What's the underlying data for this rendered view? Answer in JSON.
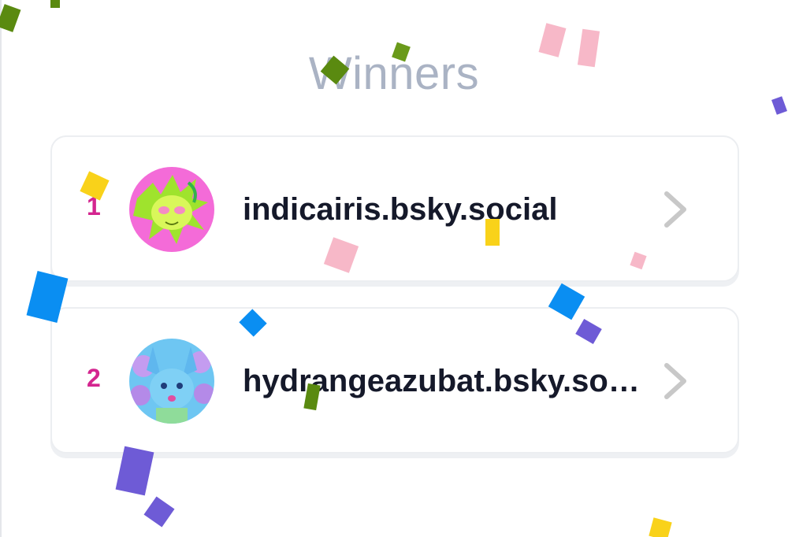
{
  "header": {
    "title": "Winners"
  },
  "winners": [
    {
      "rank": "1",
      "handle": "indicairis.bsky.social"
    },
    {
      "rank": "2",
      "handle": "hydrangeazubat.bsky.so…"
    }
  ],
  "colors": {
    "title": "#aab3c4",
    "rank": "#d4258f",
    "handle": "#15192a",
    "chevron": "#c8c8c8",
    "card_border": "#eceef1"
  }
}
